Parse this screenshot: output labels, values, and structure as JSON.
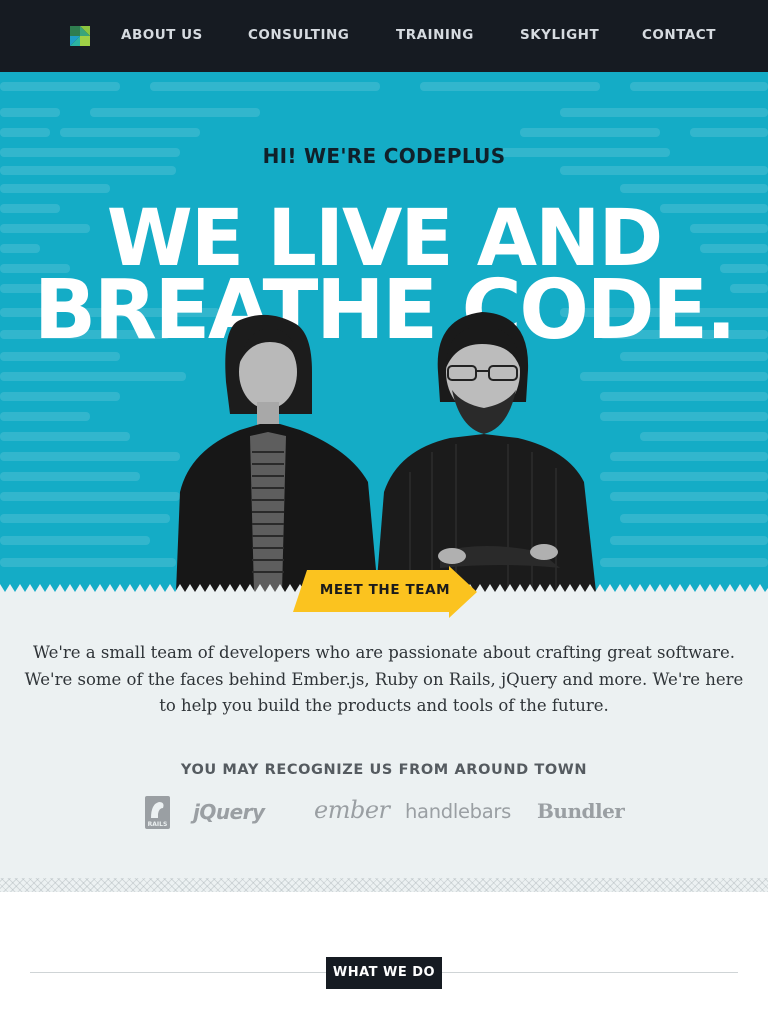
{
  "nav": {
    "logo_icon": "codeplus-logo-icon",
    "items": [
      {
        "label": "ABOUT US"
      },
      {
        "label": "CONSULTING"
      },
      {
        "label": "TRAINING"
      },
      {
        "label": "SKYLIGHT"
      },
      {
        "label": "CONTACT"
      }
    ]
  },
  "hero": {
    "greeting": "HI! WE'RE CODEPLUS",
    "headline_line1": "WE LIVE AND",
    "headline_line2": "BREATHE CODE.",
    "cta_label": "MEET THE TEAM"
  },
  "about": {
    "intro": "We're a small team of developers who are passionate about crafting great software. We're some of the faces behind Ember.js, Ruby on Rails, jQuery and more. We're here to help you build the products and tools of the future.",
    "recognize_heading": "YOU MAY RECOGNIZE US FROM AROUND TOWN",
    "brands": [
      {
        "name": "rails",
        "icon": "rails-logo-icon",
        "label": "RAILS"
      },
      {
        "name": "jquery",
        "label": "jQuery"
      },
      {
        "name": "ember",
        "label": "ember"
      },
      {
        "name": "handlebars",
        "label": "handlebars"
      },
      {
        "name": "bundler",
        "label": "Bundler"
      }
    ]
  },
  "what_we_do": {
    "heading": "WHAT WE DO"
  },
  "colors": {
    "nav_bg": "#161b22",
    "hero_bg": "#14acc6",
    "accent_yellow": "#fbc31f",
    "about_bg": "#ecf1f2"
  }
}
